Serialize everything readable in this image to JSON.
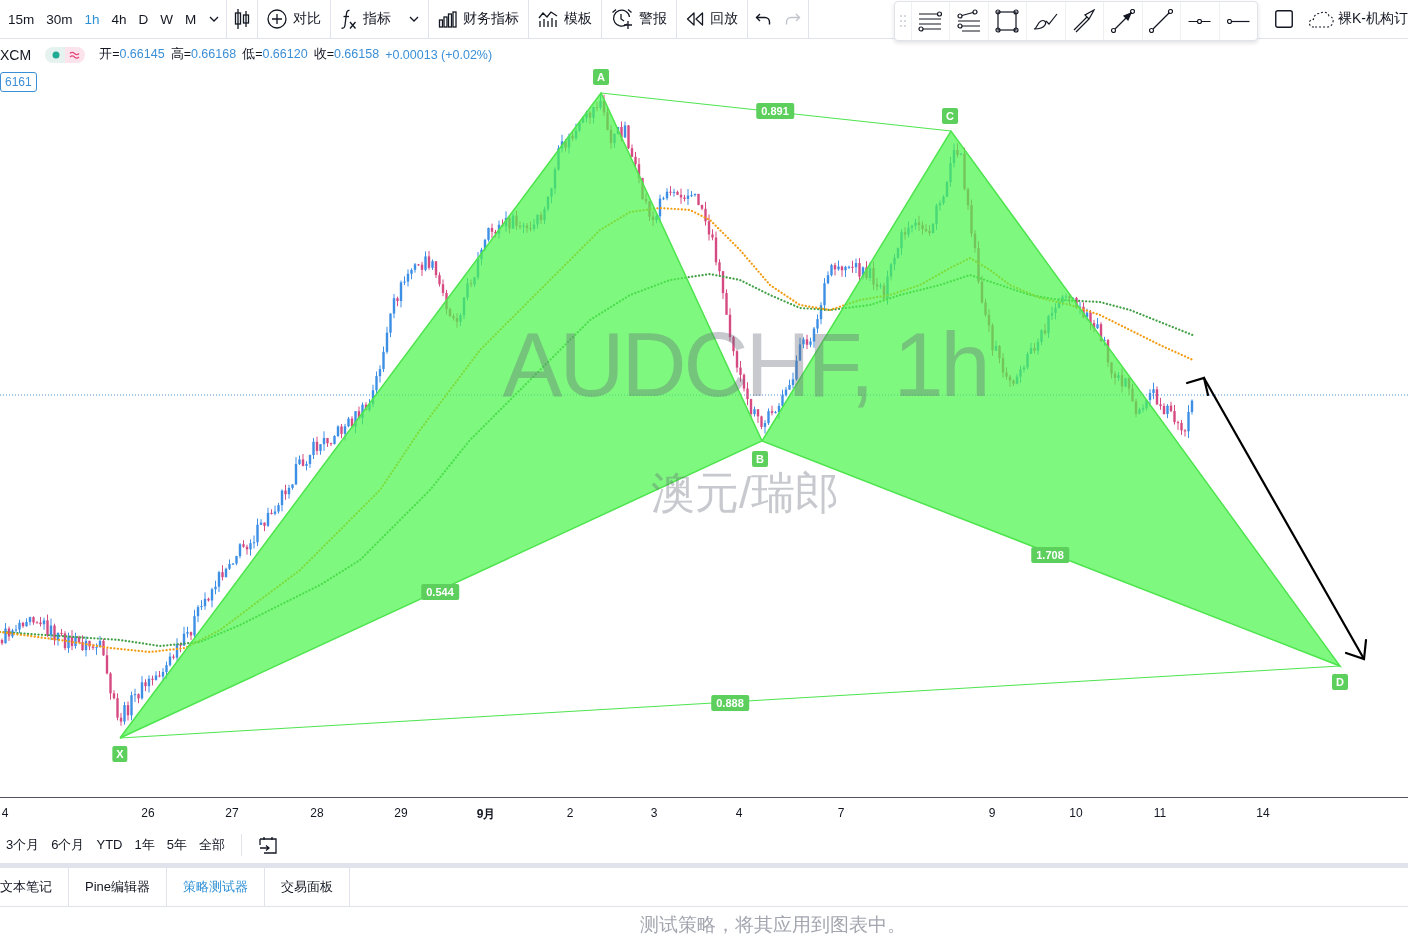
{
  "toolbar": {
    "intervals": [
      {
        "label": "15m",
        "selected": false
      },
      {
        "label": "30m",
        "selected": false
      },
      {
        "label": "1h",
        "selected": true
      },
      {
        "label": "4h",
        "selected": false
      },
      {
        "label": "D",
        "selected": false
      },
      {
        "label": "W",
        "selected": false
      },
      {
        "label": "M",
        "selected": false
      }
    ],
    "actions": [
      {
        "kind": "compare",
        "label": "对比",
        "menu": false
      },
      {
        "kind": "indicators",
        "label": "指标",
        "menu": true
      },
      {
        "kind": "financials",
        "label": "财务指标",
        "menu": false
      },
      {
        "kind": "templates",
        "label": "模板",
        "menu": false
      },
      {
        "kind": "alerts",
        "label": "警报",
        "menu": false
      },
      {
        "kind": "replay",
        "label": "回放",
        "menu": false
      }
    ],
    "undo": {
      "disabled": false
    },
    "redo": {
      "disabled": true
    },
    "layout_name": "裸K-机构订"
  },
  "legend": {
    "symbol": "XCM",
    "ohlc": [
      {
        "label": "开=",
        "value": "0.66145"
      },
      {
        "label": "高=",
        "value": "0.66168"
      },
      {
        "label": "低=",
        "value": "0.66120"
      },
      {
        "label": "收=",
        "value": "0.66158"
      }
    ],
    "change": "+0.00013 (+0.02%)",
    "price_tag": "6161"
  },
  "chart": {
    "watermark": {
      "symbol": "AUDCHF, 1h",
      "name": "澳元/瑞郎"
    },
    "pattern": {
      "points": [
        "X",
        "A",
        "B",
        "C",
        "D"
      ],
      "ratios": [
        "0.891",
        "1.708",
        "0.544",
        "0.888"
      ]
    }
  },
  "time_axis": [
    {
      "label": "4",
      "kind": "day"
    },
    {
      "label": "26",
      "kind": "day"
    },
    {
      "label": "27",
      "kind": "day"
    },
    {
      "label": "28",
      "kind": "day"
    },
    {
      "label": "29",
      "kind": "day"
    },
    {
      "label": "9月",
      "kind": "month"
    },
    {
      "label": "2",
      "kind": "day"
    },
    {
      "label": "3",
      "kind": "day"
    },
    {
      "label": "4",
      "kind": "day"
    },
    {
      "label": "7",
      "kind": "day"
    },
    {
      "label": "9",
      "kind": "day"
    },
    {
      "label": "10",
      "kind": "day"
    },
    {
      "label": "11",
      "kind": "day"
    },
    {
      "label": "14",
      "kind": "day"
    }
  ],
  "ranges": [
    "3个月",
    "6个月",
    "YTD",
    "1年",
    "5年",
    "全部"
  ],
  "bottom_panel": {
    "tabs": [
      {
        "label": "文本笔记",
        "selected": false
      },
      {
        "label": "Pine编辑器",
        "selected": false
      },
      {
        "label": "策略测试器",
        "selected": true
      },
      {
        "label": "交易面板",
        "selected": false
      }
    ],
    "message": "测试策略，将其应用到图表中。"
  }
}
